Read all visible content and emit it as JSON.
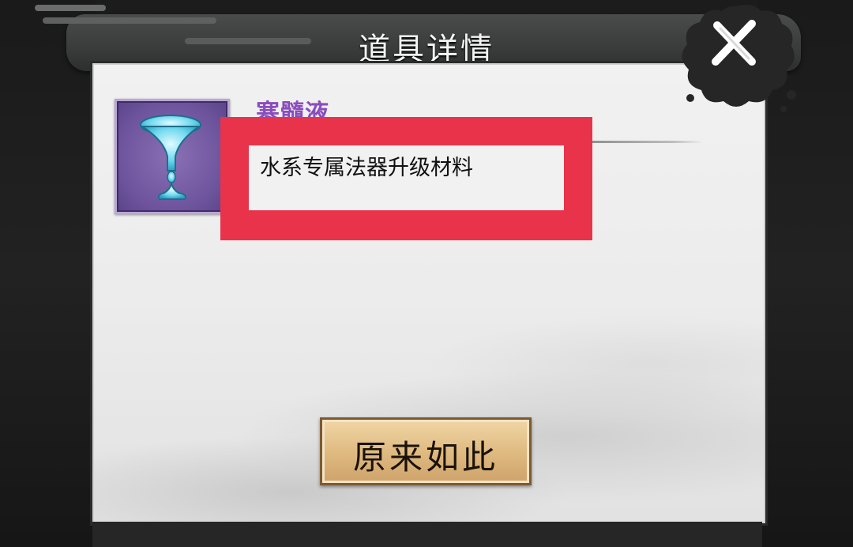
{
  "dialog": {
    "title": "道具详情",
    "close_icon": "close-x-icon"
  },
  "item": {
    "name": "寒髓液",
    "icon": "water-drop-chalice-icon",
    "description": "水系专属法器升级材料",
    "name_color": "#8a4dbd",
    "icon_bg_color": "#6c539c"
  },
  "confirm": {
    "label": "原来如此"
  },
  "annotation": {
    "highlight_color": "#e8334a"
  }
}
